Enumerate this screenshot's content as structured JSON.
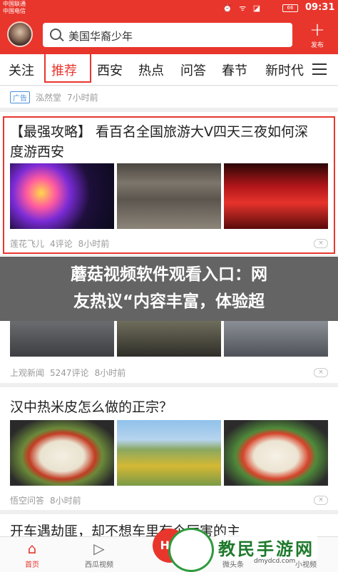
{
  "status_bar": {
    "carrier_1": "中国联通",
    "carrier_2": "中国电信",
    "icons": "⏰ ᯤ ◪",
    "battery": "66",
    "time": "09:31"
  },
  "search": {
    "query": "美国华裔少年",
    "publish_label": "发布"
  },
  "tabs": [
    "关注",
    "推荐",
    "西安",
    "热点",
    "问答",
    "春节",
    "新时代"
  ],
  "active_tab": "推荐",
  "feed": {
    "ad": {
      "tag": "广告",
      "source": "泓然堂",
      "time": "7小时前"
    },
    "article_1": {
      "title_line_1": "【最强攻略】 看百名全国旅游大V四天三夜如何深",
      "title_line_2": "度游西安",
      "source": "莲花飞儿",
      "comments": "4评论",
      "time": "8小时前"
    },
    "article_2": {
      "source": "上观新闻",
      "comments": "5247评论",
      "time": "8小时前"
    },
    "article_3": {
      "title": "汉中热米皮怎么做的正宗？",
      "source": "悟空问答",
      "time": "8小时前"
    },
    "article_4": {
      "title": "开车遇劫匪，却不想车里有个厉害的主"
    },
    "close_glyph": "×"
  },
  "overlay_caption": {
    "line_1": "蘑菇视频软件观看入口：网",
    "line_2": "友热议“内容丰富，体验超"
  },
  "bottom_nav": [
    {
      "label": "首页",
      "icon": "home-icon",
      "glyph": "⌂"
    },
    {
      "label": "西瓜视频",
      "icon": "play-icon",
      "glyph": "▷"
    },
    {
      "label": "微头条",
      "icon": "post-icon",
      "glyph": "✎"
    },
    {
      "label": "小视频",
      "icon": "video-icon",
      "glyph": "▶"
    }
  ],
  "center_button": "HO",
  "watermark": {
    "text": "教民手游网",
    "url": "dmydcd.com"
  },
  "colors": {
    "brand_red": "#e8362d",
    "meta_gray": "#999999"
  }
}
